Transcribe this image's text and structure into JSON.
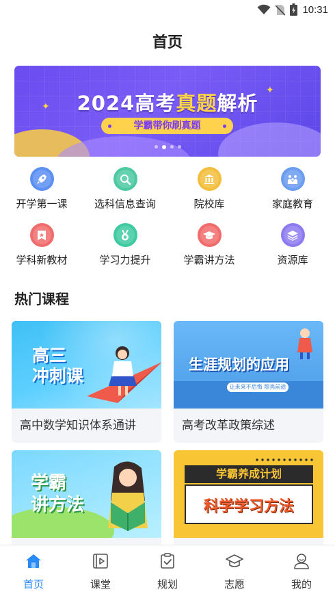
{
  "status_bar": {
    "time": "10:31",
    "icons": [
      "wifi-icon",
      "no-sim-icon",
      "battery-charging-icon"
    ]
  },
  "header": {
    "title": "首页"
  },
  "banner": {
    "headline_pre": "2024高考",
    "headline_highlight": "真题",
    "headline_post": "解析",
    "pill_text": "学霸带你刷真题",
    "page_count": 4,
    "active_page": 2
  },
  "quick_links": [
    {
      "label": "开学第一课",
      "icon": "rocket-icon",
      "color": "#5b8ff2"
    },
    {
      "label": "选科信息查询",
      "icon": "magnifier-icon",
      "color": "#4cc9a0"
    },
    {
      "label": "院校库",
      "icon": "building-icon",
      "color": "#f3be3d"
    },
    {
      "label": "家庭教育",
      "icon": "family-icon",
      "color": "#6a9cf0"
    },
    {
      "label": "学科新教材",
      "icon": "book-star-icon",
      "color": "#f06b6b"
    },
    {
      "label": "学习力提升",
      "icon": "medal-icon",
      "color": "#3fcaa2"
    },
    {
      "label": "学霸讲方法",
      "icon": "graduation-cap-icon",
      "color": "#f26b6b"
    },
    {
      "label": "资源库",
      "icon": "layers-icon",
      "color": "#8c7bf0"
    }
  ],
  "section": {
    "title": "热门课程"
  },
  "courses": [
    {
      "title": "高中数学知识体系通讲",
      "thumb_text": "高三\n冲刺课"
    },
    {
      "title": "高考改革政策综述",
      "thumb_text": "生涯规划的应用",
      "thumb_sub": "让未来不后悔 照亮前途"
    },
    {
      "title": "",
      "thumb_text": "学霸\n讲方法"
    },
    {
      "title": "",
      "thumb_text": "科学学习方法",
      "thumb_sub": "学霸养成计划"
    }
  ],
  "bottom_nav": [
    {
      "label": "首页",
      "icon": "home-icon",
      "active": true
    },
    {
      "label": "课堂",
      "icon": "play-book-icon",
      "active": false
    },
    {
      "label": "规划",
      "icon": "clipboard-check-icon",
      "active": false
    },
    {
      "label": "志愿",
      "icon": "graduation-cap-icon",
      "active": false
    },
    {
      "label": "我的",
      "icon": "user-icon",
      "active": false
    }
  ],
  "colors": {
    "accent": "#2a8af6",
    "banner": "#6a4cf0",
    "highlight": "#ffd447"
  }
}
